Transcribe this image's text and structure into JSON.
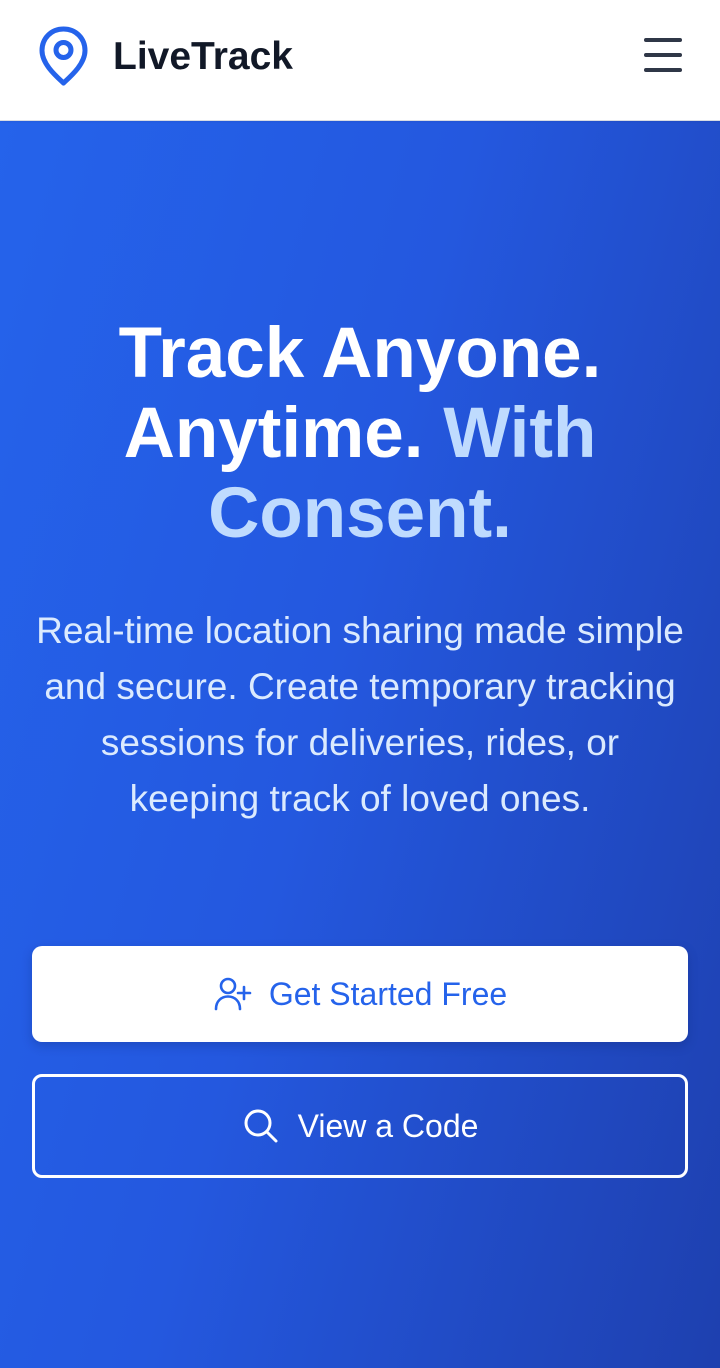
{
  "header": {
    "app_name": "LiveTrack",
    "logo_icon": "map-pin-icon",
    "menu_icon": "hamburger-menu-icon"
  },
  "hero": {
    "title_line1": "Track Anyone.",
    "title_line2_white": "Anytime.",
    "title_line2_accent": "With",
    "title_line3_accent": "Consent.",
    "subtitle": "Real-time location sharing made simple and secure. Create temporary tracking sessions for deliveries, rides, or keeping track of loved ones."
  },
  "actions": {
    "primary": {
      "label": "Get Started Free",
      "icon": "user-plus-icon"
    },
    "secondary": {
      "label": "View a Code",
      "icon": "search-icon"
    }
  },
  "colors": {
    "brand": "#2563eb",
    "brand_dark": "#1e40af",
    "accent_text": "#bfdbfe",
    "header_text": "#111827"
  }
}
